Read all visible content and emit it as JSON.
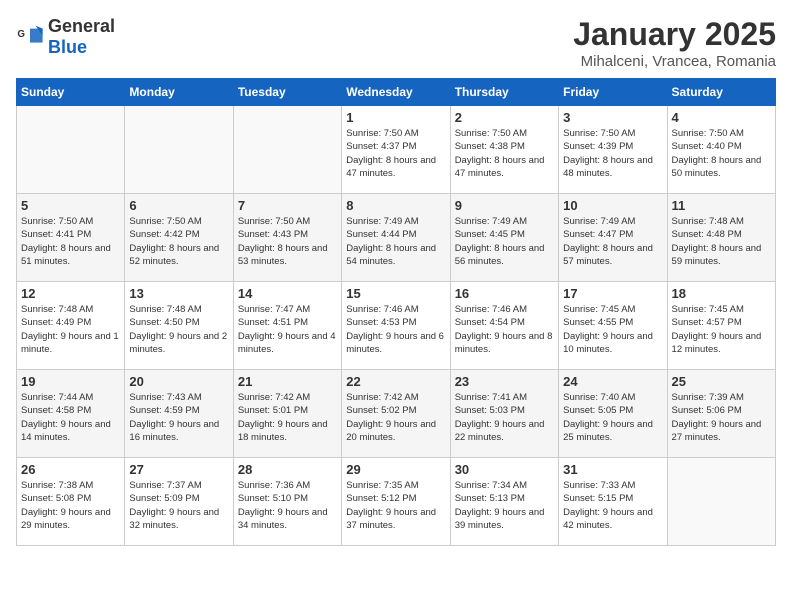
{
  "logo": {
    "general": "General",
    "blue": "Blue"
  },
  "header": {
    "title": "January 2025",
    "subtitle": "Mihalceni, Vrancea, Romania"
  },
  "days_of_week": [
    "Sunday",
    "Monday",
    "Tuesday",
    "Wednesday",
    "Thursday",
    "Friday",
    "Saturday"
  ],
  "weeks": [
    [
      {
        "day": "",
        "info": ""
      },
      {
        "day": "",
        "info": ""
      },
      {
        "day": "",
        "info": ""
      },
      {
        "day": "1",
        "info": "Sunrise: 7:50 AM\nSunset: 4:37 PM\nDaylight: 8 hours and 47 minutes."
      },
      {
        "day": "2",
        "info": "Sunrise: 7:50 AM\nSunset: 4:38 PM\nDaylight: 8 hours and 47 minutes."
      },
      {
        "day": "3",
        "info": "Sunrise: 7:50 AM\nSunset: 4:39 PM\nDaylight: 8 hours and 48 minutes."
      },
      {
        "day": "4",
        "info": "Sunrise: 7:50 AM\nSunset: 4:40 PM\nDaylight: 8 hours and 50 minutes."
      }
    ],
    [
      {
        "day": "5",
        "info": "Sunrise: 7:50 AM\nSunset: 4:41 PM\nDaylight: 8 hours and 51 minutes."
      },
      {
        "day": "6",
        "info": "Sunrise: 7:50 AM\nSunset: 4:42 PM\nDaylight: 8 hours and 52 minutes."
      },
      {
        "day": "7",
        "info": "Sunrise: 7:50 AM\nSunset: 4:43 PM\nDaylight: 8 hours and 53 minutes."
      },
      {
        "day": "8",
        "info": "Sunrise: 7:49 AM\nSunset: 4:44 PM\nDaylight: 8 hours and 54 minutes."
      },
      {
        "day": "9",
        "info": "Sunrise: 7:49 AM\nSunset: 4:45 PM\nDaylight: 8 hours and 56 minutes."
      },
      {
        "day": "10",
        "info": "Sunrise: 7:49 AM\nSunset: 4:47 PM\nDaylight: 8 hours and 57 minutes."
      },
      {
        "day": "11",
        "info": "Sunrise: 7:48 AM\nSunset: 4:48 PM\nDaylight: 8 hours and 59 minutes."
      }
    ],
    [
      {
        "day": "12",
        "info": "Sunrise: 7:48 AM\nSunset: 4:49 PM\nDaylight: 9 hours and 1 minute."
      },
      {
        "day": "13",
        "info": "Sunrise: 7:48 AM\nSunset: 4:50 PM\nDaylight: 9 hours and 2 minutes."
      },
      {
        "day": "14",
        "info": "Sunrise: 7:47 AM\nSunset: 4:51 PM\nDaylight: 9 hours and 4 minutes."
      },
      {
        "day": "15",
        "info": "Sunrise: 7:46 AM\nSunset: 4:53 PM\nDaylight: 9 hours and 6 minutes."
      },
      {
        "day": "16",
        "info": "Sunrise: 7:46 AM\nSunset: 4:54 PM\nDaylight: 9 hours and 8 minutes."
      },
      {
        "day": "17",
        "info": "Sunrise: 7:45 AM\nSunset: 4:55 PM\nDaylight: 9 hours and 10 minutes."
      },
      {
        "day": "18",
        "info": "Sunrise: 7:45 AM\nSunset: 4:57 PM\nDaylight: 9 hours and 12 minutes."
      }
    ],
    [
      {
        "day": "19",
        "info": "Sunrise: 7:44 AM\nSunset: 4:58 PM\nDaylight: 9 hours and 14 minutes."
      },
      {
        "day": "20",
        "info": "Sunrise: 7:43 AM\nSunset: 4:59 PM\nDaylight: 9 hours and 16 minutes."
      },
      {
        "day": "21",
        "info": "Sunrise: 7:42 AM\nSunset: 5:01 PM\nDaylight: 9 hours and 18 minutes."
      },
      {
        "day": "22",
        "info": "Sunrise: 7:42 AM\nSunset: 5:02 PM\nDaylight: 9 hours and 20 minutes."
      },
      {
        "day": "23",
        "info": "Sunrise: 7:41 AM\nSunset: 5:03 PM\nDaylight: 9 hours and 22 minutes."
      },
      {
        "day": "24",
        "info": "Sunrise: 7:40 AM\nSunset: 5:05 PM\nDaylight: 9 hours and 25 minutes."
      },
      {
        "day": "25",
        "info": "Sunrise: 7:39 AM\nSunset: 5:06 PM\nDaylight: 9 hours and 27 minutes."
      }
    ],
    [
      {
        "day": "26",
        "info": "Sunrise: 7:38 AM\nSunset: 5:08 PM\nDaylight: 9 hours and 29 minutes."
      },
      {
        "day": "27",
        "info": "Sunrise: 7:37 AM\nSunset: 5:09 PM\nDaylight: 9 hours and 32 minutes."
      },
      {
        "day": "28",
        "info": "Sunrise: 7:36 AM\nSunset: 5:10 PM\nDaylight: 9 hours and 34 minutes."
      },
      {
        "day": "29",
        "info": "Sunrise: 7:35 AM\nSunset: 5:12 PM\nDaylight: 9 hours and 37 minutes."
      },
      {
        "day": "30",
        "info": "Sunrise: 7:34 AM\nSunset: 5:13 PM\nDaylight: 9 hours and 39 minutes."
      },
      {
        "day": "31",
        "info": "Sunrise: 7:33 AM\nSunset: 5:15 PM\nDaylight: 9 hours and 42 minutes."
      },
      {
        "day": "",
        "info": ""
      }
    ]
  ]
}
